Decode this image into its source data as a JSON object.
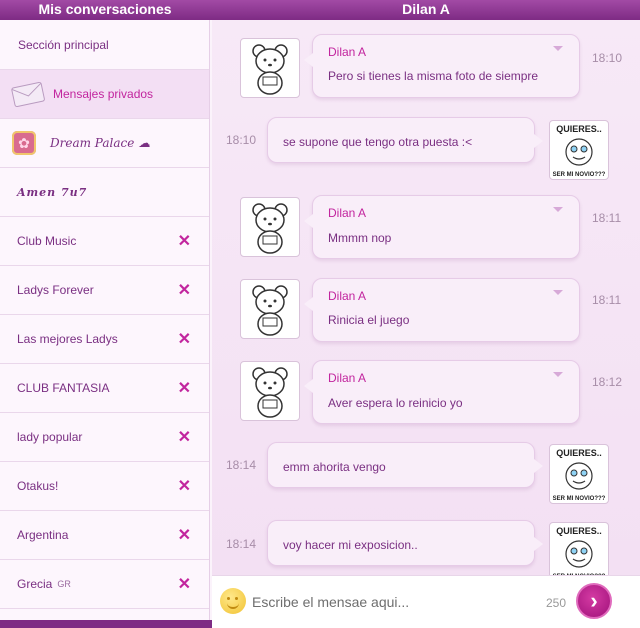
{
  "header": {
    "left_title": "Mis conversaciones",
    "right_title": "Dilan A"
  },
  "sidebar": {
    "items": [
      {
        "label": "Sección principal"
      },
      {
        "label": "Mensajes privados"
      },
      {
        "label": "Dream Palace ☁"
      },
      {
        "label": "Amen 7u7"
      },
      {
        "label": "Club Music"
      },
      {
        "label": "Ladys Forever"
      },
      {
        "label": "Las mejores Ladys"
      },
      {
        "label": "CLUB FANTASIA"
      },
      {
        "label": "lady popular"
      },
      {
        "label": "Otakus!"
      },
      {
        "label": "Argentina"
      },
      {
        "label": "Grecia",
        "tag": "GR"
      }
    ],
    "close_glyph": "✕"
  },
  "messages": [
    {
      "direction": "in",
      "sender": "Dilan A",
      "text": "Pero si tienes la misma foto de siempre",
      "time": "18:10",
      "avatar": "bear-avatar"
    },
    {
      "direction": "out",
      "text": "se supone que tengo otra puesta :<",
      "time": "18:10",
      "avatar": "meme-avatar"
    },
    {
      "direction": "in",
      "sender": "Dilan A",
      "text": "Mmmm nop",
      "time": "18:11",
      "avatar": "bear-avatar"
    },
    {
      "direction": "in",
      "sender": "Dilan A",
      "text": "Rinicia el juego",
      "time": "18:11",
      "avatar": "bear-avatar"
    },
    {
      "direction": "in",
      "sender": "Dilan A",
      "text": "Aver espera lo reinicio yo",
      "time": "18:12",
      "avatar": "bear-avatar"
    },
    {
      "direction": "out",
      "text": "emm ahorita vengo",
      "time": "18:14",
      "avatar": "meme-avatar"
    },
    {
      "direction": "out",
      "text": "voy hacer mi exposicion..",
      "time": "18:14",
      "avatar": "meme-avatar"
    }
  ],
  "meme_text": {
    "top": "QUIERES..",
    "bottom": "SER MI NOVIO???"
  },
  "composer": {
    "placeholder": "Escribe el mensae aqui...",
    "counter": "250",
    "send_glyph": "›"
  },
  "colors": {
    "accent": "#c2259e",
    "header": "#7e2b84",
    "text": "#7a2f82"
  }
}
